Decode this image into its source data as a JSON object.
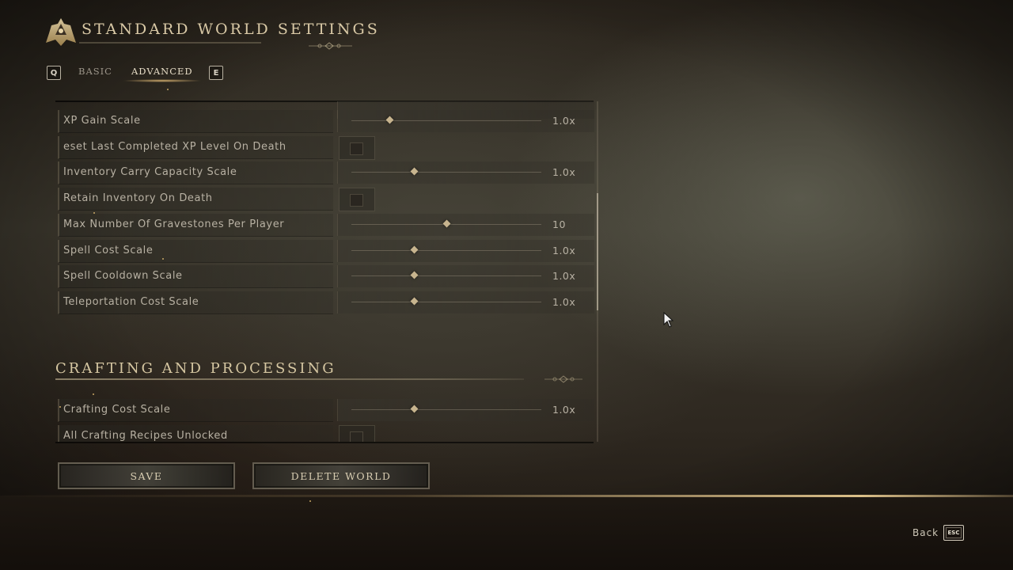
{
  "header": {
    "title": "STANDARD WORLD SETTINGS"
  },
  "tabs": {
    "prev_key": "Q",
    "next_key": "E",
    "items": [
      {
        "label": "BASIC",
        "active": false
      },
      {
        "label": "ADVANCED",
        "active": true
      }
    ]
  },
  "settings": {
    "rows": [
      {
        "label": "XP Gain Scale",
        "type": "slider",
        "value": "1.0x",
        "fraction": 0.2
      },
      {
        "label": "eset Last Completed XP Level On Death",
        "type": "checkbox",
        "checked": false
      },
      {
        "label": "Inventory Carry Capacity Scale",
        "type": "slider",
        "value": "1.0x",
        "fraction": 0.33
      },
      {
        "label": "Retain Inventory On Death",
        "type": "checkbox",
        "checked": false
      },
      {
        "label": "Max Number Of Gravestones Per Player",
        "type": "slider",
        "value": "10",
        "fraction": 0.5
      },
      {
        "label": "Spell Cost Scale",
        "type": "slider",
        "value": "1.0x",
        "fraction": 0.33
      },
      {
        "label": "Spell Cooldown Scale",
        "type": "slider",
        "value": "1.0x",
        "fraction": 0.33
      },
      {
        "label": "Teleportation Cost Scale",
        "type": "slider",
        "value": "1.0x",
        "fraction": 0.33
      }
    ],
    "section_title": "CRAFTING AND PROCESSING",
    "section_rows": [
      {
        "label": "Crafting Cost Scale",
        "type": "slider",
        "value": "1.0x",
        "fraction": 0.33
      },
      {
        "label": "All Crafting Recipes Unlocked",
        "type": "checkbox",
        "checked": false
      }
    ]
  },
  "buttons": {
    "save": "SAVE",
    "delete": "DELETE WORLD"
  },
  "footer": {
    "back_label": "Back",
    "back_key": "ESC"
  },
  "colors": {
    "accent_gold": "#d9c9a6",
    "knob": "#c7b48e",
    "text": "#b8b1a3"
  }
}
